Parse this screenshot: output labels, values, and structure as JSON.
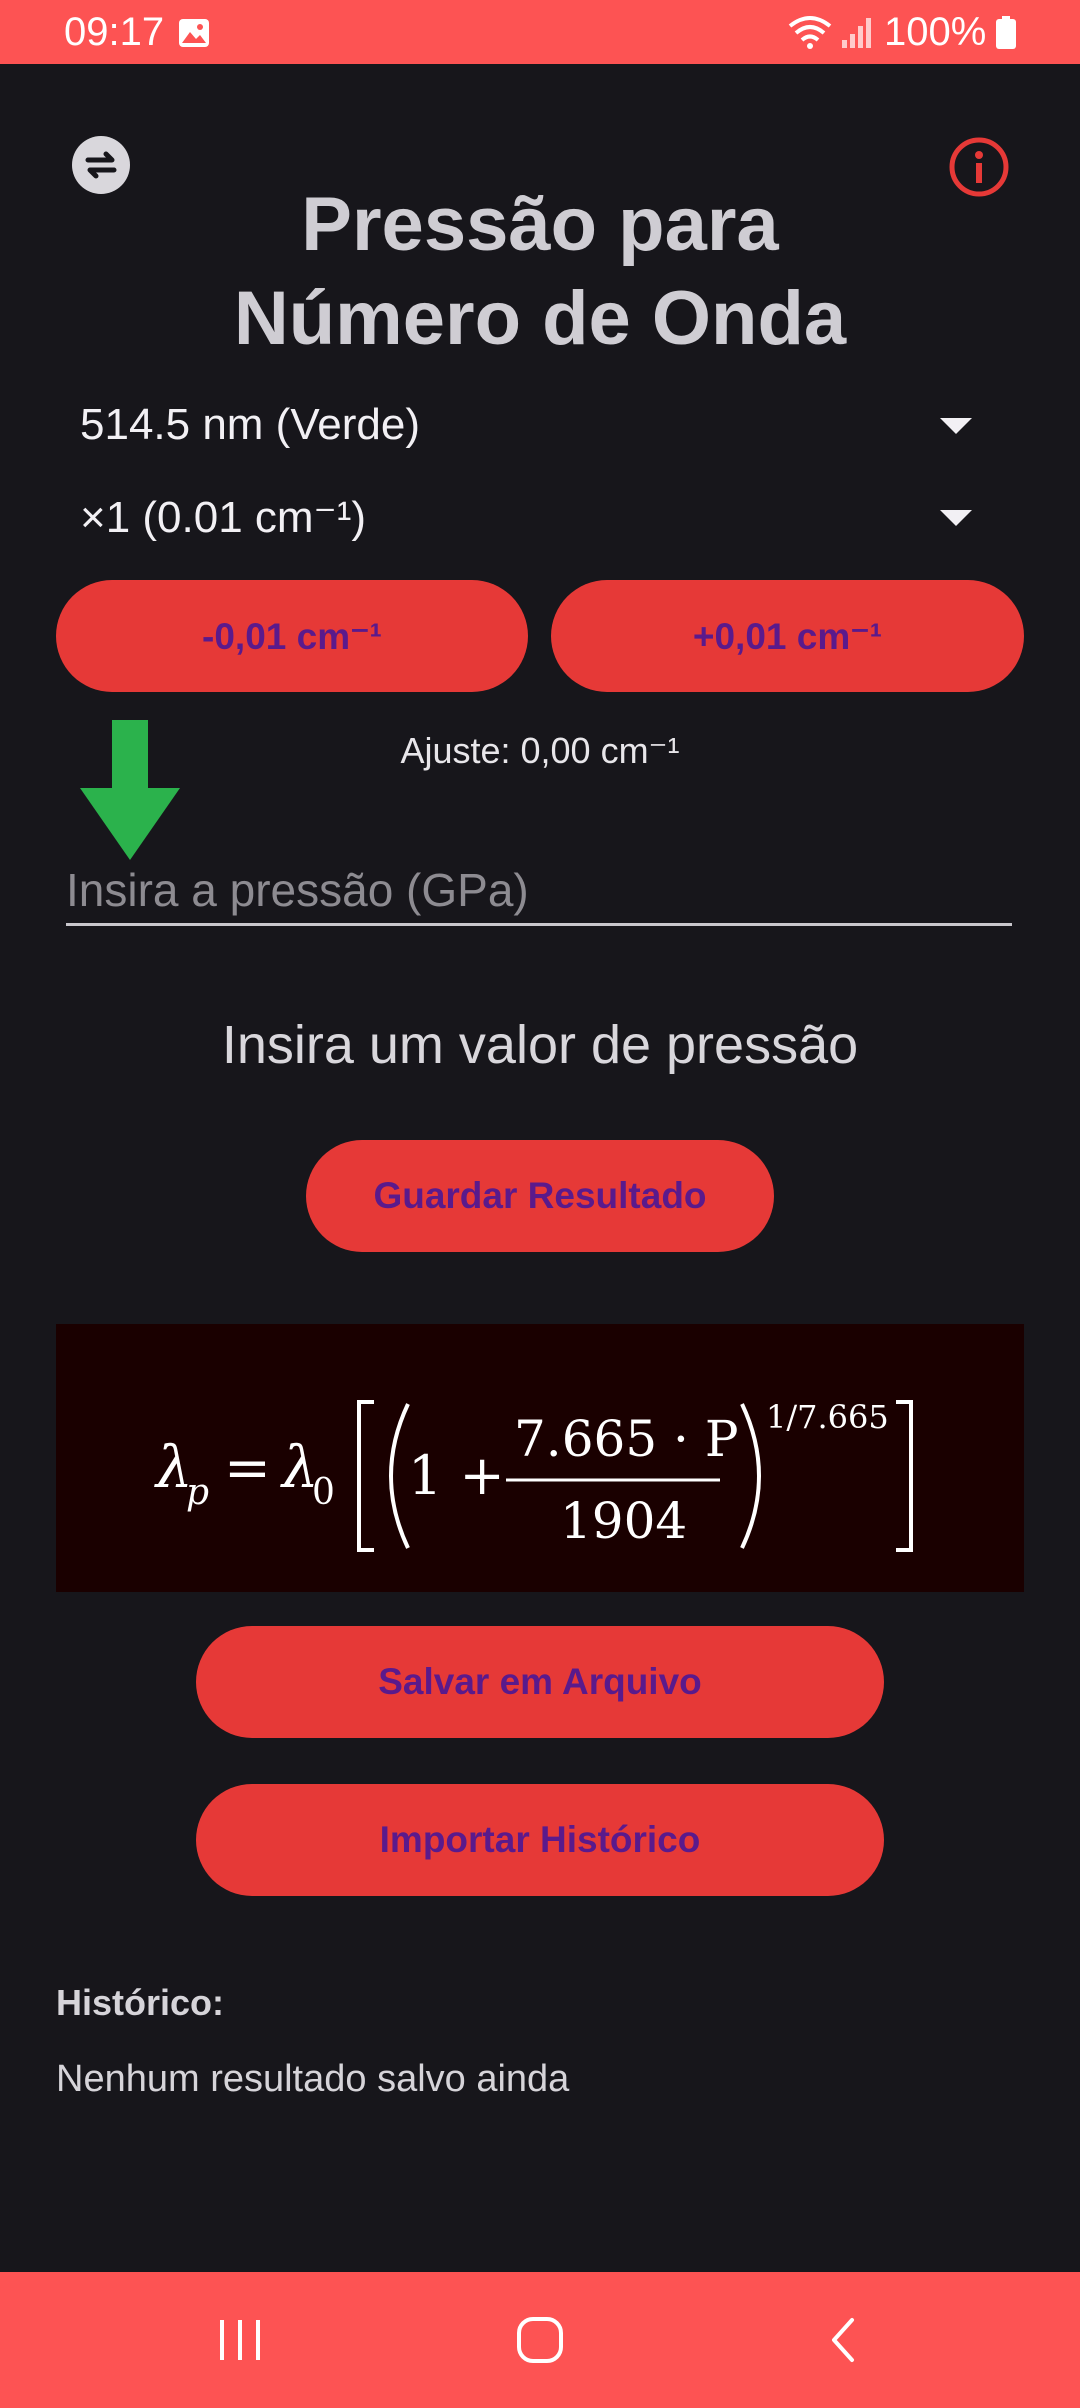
{
  "status_bar": {
    "time": "09:17",
    "battery": "100%",
    "background": "#fd5353"
  },
  "header": {
    "title_line1": "Pressão para",
    "title_line2": "Número de Onda",
    "swap_icon": "swap-icon",
    "info_icon": "info-icon"
  },
  "dropdowns": {
    "wavelength": "514.5 nm (Verde)",
    "step": "×1 (0.01 cm⁻¹)"
  },
  "adjust": {
    "minus_label": "-0,01 cm⁻¹",
    "plus_label": "+0,01 cm⁻¹",
    "status": "Ajuste: 0,00 cm⁻¹"
  },
  "input": {
    "placeholder": "Insira a pressão (GPa)",
    "value": ""
  },
  "result": {
    "prompt": "Insira um valor de pressão",
    "save_label": "Guardar Resultado"
  },
  "formula": {
    "lhs": "λ",
    "lhs_sub": "p",
    "rhs_lambda": "λ",
    "rhs_sub": "0",
    "one_plus": "1 +",
    "numerator": "7.665 · P",
    "denominator": "1904",
    "exponent": "1/7.665"
  },
  "file_actions": {
    "save_file_label": "Salvar em Arquivo",
    "import_label": "Importar Histórico"
  },
  "history": {
    "title": "Histórico:",
    "empty_text": "Nenhum resultado salvo ainda"
  },
  "colors": {
    "accent": "#e63937",
    "button_text": "#5a1a8c",
    "background": "#17161b",
    "arrow": "#2bb24c"
  }
}
